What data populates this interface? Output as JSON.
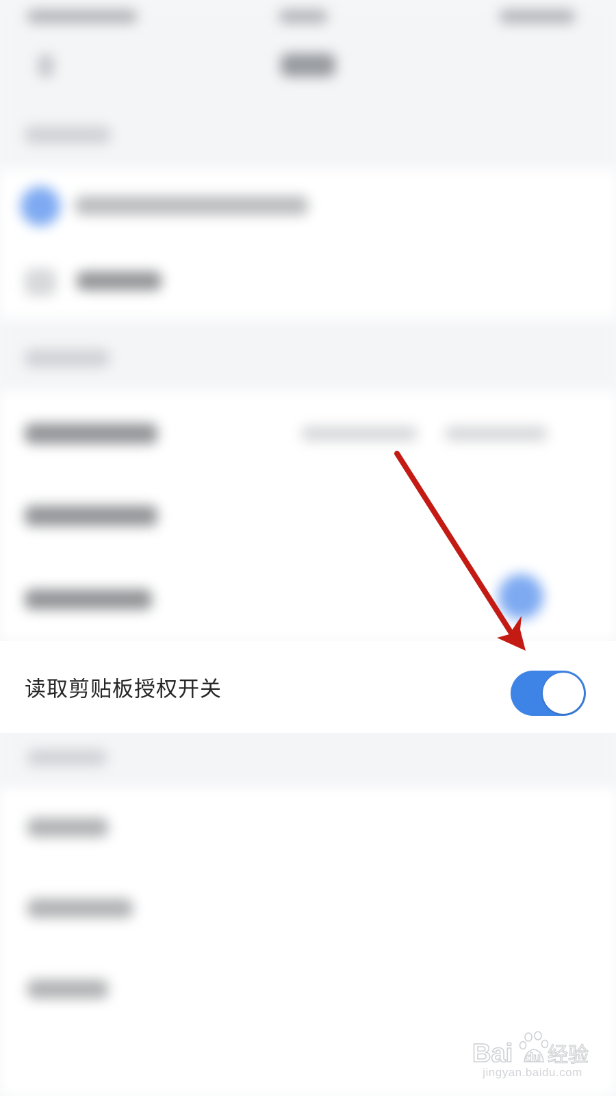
{
  "settings": {
    "clipboard_row": {
      "label": "读取剪贴板授权开关",
      "toggle_state": "on"
    }
  },
  "colors": {
    "toggle_on": "#3e83e6",
    "annotation_arrow": "#c31b14",
    "page_background": "#f5f6f8",
    "row_background": "#ffffff"
  },
  "watermark": {
    "brand_latin": "Bai",
    "brand_du": "du",
    "brand_cn": "经验",
    "domain": "jingyan.baidu.com"
  }
}
